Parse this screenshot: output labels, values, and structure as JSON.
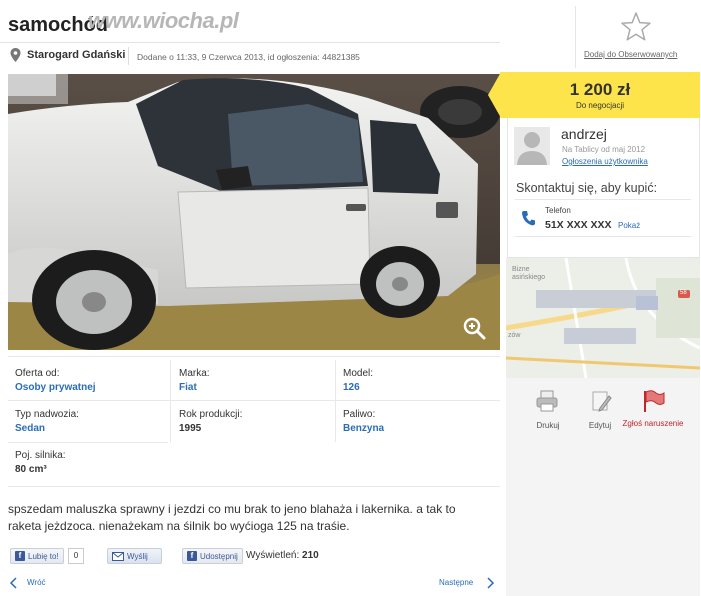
{
  "header": {
    "title": "samochód",
    "watermark": "www.wiocha.pl",
    "location": "Starogard Gdański",
    "added": "Dodane o 11:33, 9 Czerwca 2013, id ogłoszenia: 44821385",
    "watch_label": "Dodaj do Obserwowanych"
  },
  "price": {
    "amount": "1 200 zł",
    "note": "Do negocjacji"
  },
  "seller": {
    "name": "andrzej",
    "since": "Na Tablicy od maj 2012",
    "ads_link": "Ogłoszenia użytkownika",
    "contact_heading": "Skontaktuj się, aby kupić:",
    "phone_label": "Telefon",
    "phone_number": "51X XXX XXX",
    "phone_show": "Pokaż"
  },
  "map": {
    "labels": [
      "Bizne",
      "asińskiego",
      "zów"
    ],
    "marker": "58"
  },
  "actions": [
    {
      "label": "Drukuj",
      "icon": "printer-icon"
    },
    {
      "label": "Edytuj",
      "icon": "edit-icon"
    },
    {
      "label": "Zgłoś naruszenie",
      "icon": "flag-icon"
    }
  ],
  "details": [
    {
      "label": "Oferta od:",
      "value": "Osoby prywatnej",
      "link": true
    },
    {
      "label": "Marka:",
      "value": "Fiat",
      "link": true
    },
    {
      "label": "Model:",
      "value": "126",
      "link": true
    },
    {
      "label": "Typ nadwozia:",
      "value": "Sedan",
      "link": true
    },
    {
      "label": "Rok produkcji:",
      "value": "1995",
      "link": false
    },
    {
      "label": "Paliwo:",
      "value": "Benzyna",
      "link": true
    },
    {
      "label": "Poj. silnika:",
      "value": "80 cm³",
      "link": false
    }
  ],
  "description": "spszedam maluszka sprawny i jezdzi co mu brak to jeno blahaża i lakernika. a tak to raketa jeżdzoca. nienażekam na śilnik bo wyćioga 125 na traśie.",
  "share": {
    "like_label": "Lubię to!",
    "like_count": "0",
    "send_label": "Wyślij",
    "fb_share_label": "Udostępnij",
    "views_label": "Wyświetleń:",
    "views_count": "210"
  },
  "nav": {
    "prev": "Wróć",
    "next": "Następne"
  },
  "colors": {
    "price_bg": "#fde44a",
    "link": "#2a6db5",
    "report": "#c0262c"
  }
}
